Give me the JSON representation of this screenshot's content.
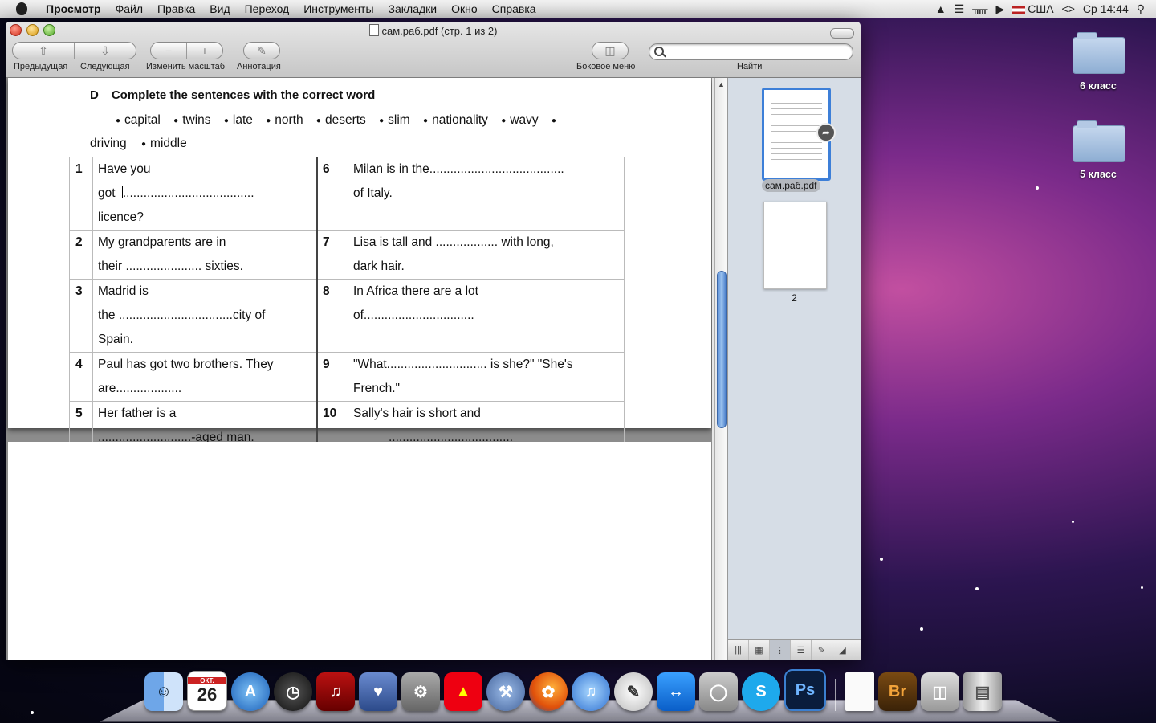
{
  "menubar": {
    "app": "Просмотр",
    "items": [
      "Файл",
      "Правка",
      "Вид",
      "Переход",
      "Инструменты",
      "Закладки",
      "Окно",
      "Справка"
    ],
    "input_source": "США",
    "clock": "Ср 14:44"
  },
  "window": {
    "title": "сам.раб.pdf (стр. 1 из 2)",
    "toolbar": {
      "prev_label": "Предыдущая",
      "next_label": "Следующая",
      "zoom_label": "Изменить масштаб",
      "annotate_label": "Аннотация",
      "sidebar_label": "Боковое меню",
      "find_label": "Найти",
      "search_placeholder": ""
    }
  },
  "document": {
    "exercise_letter": "D",
    "exercise_title": "Complete the sentences with the correct word",
    "word_bank": [
      "capital",
      "twins",
      "late",
      "north",
      "deserts",
      "slim",
      "nationality",
      "wavy",
      "driving",
      "middle"
    ],
    "rows": [
      {
        "n1": "1",
        "s1": "Have you",
        "s1b": "got ",
        "s1c": "......................................",
        "s1d": "licence?",
        "n2": "6",
        "s2": "Milan  is in  the.......................................",
        "s2b": "of Italy."
      },
      {
        "n1": "2",
        "s1": "My grandparents are in",
        "s1b": "their ...................... sixties.",
        "n2": "7",
        "s2": "Lisa is tall and .................. with long,",
        "s2b": "dark hair."
      },
      {
        "n1": "3",
        "s1": "Madrid  is",
        "s1b": "the .................................city of",
        "s1c": "Spain.",
        "n2": "8",
        "s2": "In Africa there are a lot",
        "s2b": "of................................"
      },
      {
        "n1": "4",
        "s1": "Paul has got two brothers. They",
        "s1b": "are...................",
        "n2": "9",
        "s2": "\"What............................. is she?\" \"She's",
        "s2b": "French.\""
      },
      {
        "n1": "5",
        "s1": "Her father is a",
        "s1b": "...........................-aged man.",
        "n2": "10",
        "s2": "Sally's hair is short and",
        "s2b": "...................................."
      }
    ]
  },
  "sidebar": {
    "thumb1_caption": "сам.раб.pdf",
    "thumb2_caption": "2"
  },
  "desktop": {
    "folders": [
      "6 класс",
      "5 класс"
    ]
  },
  "dock": {
    "calendar_month": "ОКТ.",
    "calendar_day": "26",
    "br_label": "Br",
    "ps_label": "Ps"
  }
}
